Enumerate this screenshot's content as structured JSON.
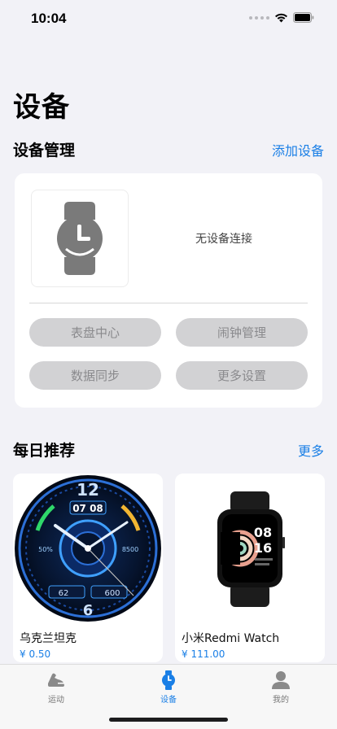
{
  "status_bar": {
    "time": "10:04"
  },
  "page_title": "设备",
  "device_section": {
    "title": "设备管理",
    "add_label": "添加设备",
    "empty_text": "无设备连接",
    "buttons": [
      "表盘中心",
      "闹钟管理",
      "数据同步",
      "更多设置"
    ]
  },
  "daily_section": {
    "title": "每日推荐",
    "more_label": "更多",
    "items": [
      {
        "name": "乌克兰坦克",
        "price": "¥ 0.50",
        "face_hour": "12",
        "face_time": "07 08",
        "face_left": "62",
        "face_right": "600",
        "face_num_left": "50%",
        "face_num_right": "8500",
        "face_bottom": "6"
      },
      {
        "name": "小米Redmi Watch",
        "price": "¥ 111.00",
        "screen_hour": "08",
        "screen_min": "16"
      }
    ]
  },
  "tab_bar": {
    "tabs": [
      {
        "label": "运动",
        "icon": "shoe-icon"
      },
      {
        "label": "设备",
        "icon": "watch-icon"
      },
      {
        "label": "我的",
        "icon": "person-icon"
      }
    ],
    "active_color": "#1a7fe6"
  },
  "colors": {
    "accent": "#1a7fe6",
    "background": "#f2f2f7",
    "pill": "#d2d2d4"
  }
}
